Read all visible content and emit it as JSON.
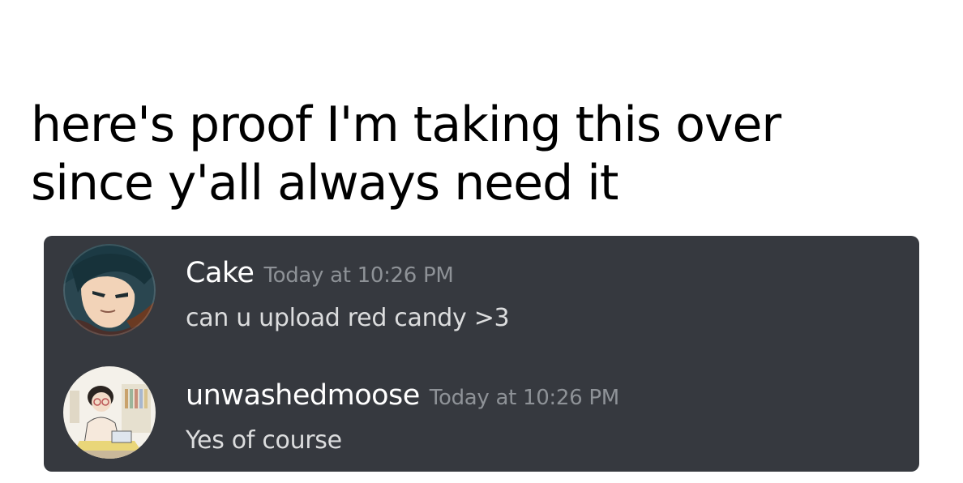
{
  "caption": {
    "line1": "here's proof I'm taking this over",
    "line2": "since y'all always need it"
  },
  "messages": [
    {
      "username": "Cake",
      "timestamp": "Today at 10:26 PM",
      "text": "can u upload red candy >3",
      "avatar_icon": "anime-character-avatar"
    },
    {
      "username": "unwashedmoose",
      "timestamp": "Today at 10:26 PM",
      "text": "Yes of course",
      "avatar_icon": "drawn-person-at-desk-avatar"
    }
  ],
  "colors": {
    "chat_background": "#36393f",
    "username": "#ffffff",
    "timestamp": "#8e9297",
    "message_text": "#dcddde"
  }
}
